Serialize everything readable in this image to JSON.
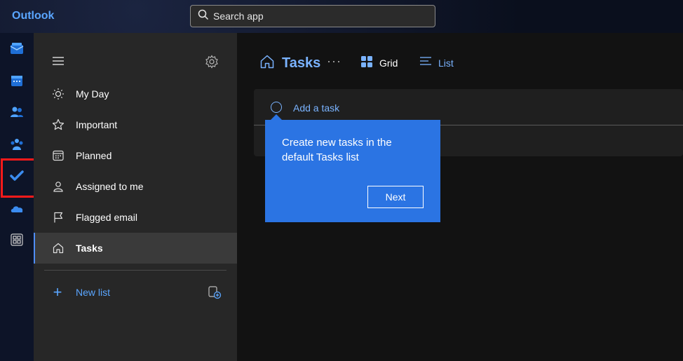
{
  "app": {
    "brand": "Outlook"
  },
  "search": {
    "placeholder": "Search app"
  },
  "rail": {
    "items": [
      {
        "name": "mail-icon"
      },
      {
        "name": "calendar-icon"
      },
      {
        "name": "people-icon"
      },
      {
        "name": "groups-icon"
      },
      {
        "name": "todo-icon",
        "highlighted": true
      },
      {
        "name": "onedrive-icon"
      },
      {
        "name": "apps-icon"
      }
    ]
  },
  "sidebar": {
    "items": [
      {
        "label": "My Day",
        "icon": "sun-icon"
      },
      {
        "label": "Important",
        "icon": "star-icon"
      },
      {
        "label": "Planned",
        "icon": "calendar-grid-icon"
      },
      {
        "label": "Assigned to me",
        "icon": "person-icon"
      },
      {
        "label": "Flagged email",
        "icon": "flag-icon"
      },
      {
        "label": "Tasks",
        "icon": "home-icon",
        "active": true
      }
    ],
    "new_list_label": "New list"
  },
  "main": {
    "title": "Tasks",
    "more_label": "···",
    "views": [
      {
        "label": "Grid",
        "active": true
      },
      {
        "label": "List",
        "active": false
      }
    ],
    "add_task_label": "Add a task"
  },
  "callout": {
    "text": "Create new tasks in the default Tasks list",
    "next_label": "Next"
  },
  "colors": {
    "accent": "#5aa6ff",
    "callout": "#2b74e3",
    "highlight": "#ff1a1a"
  }
}
